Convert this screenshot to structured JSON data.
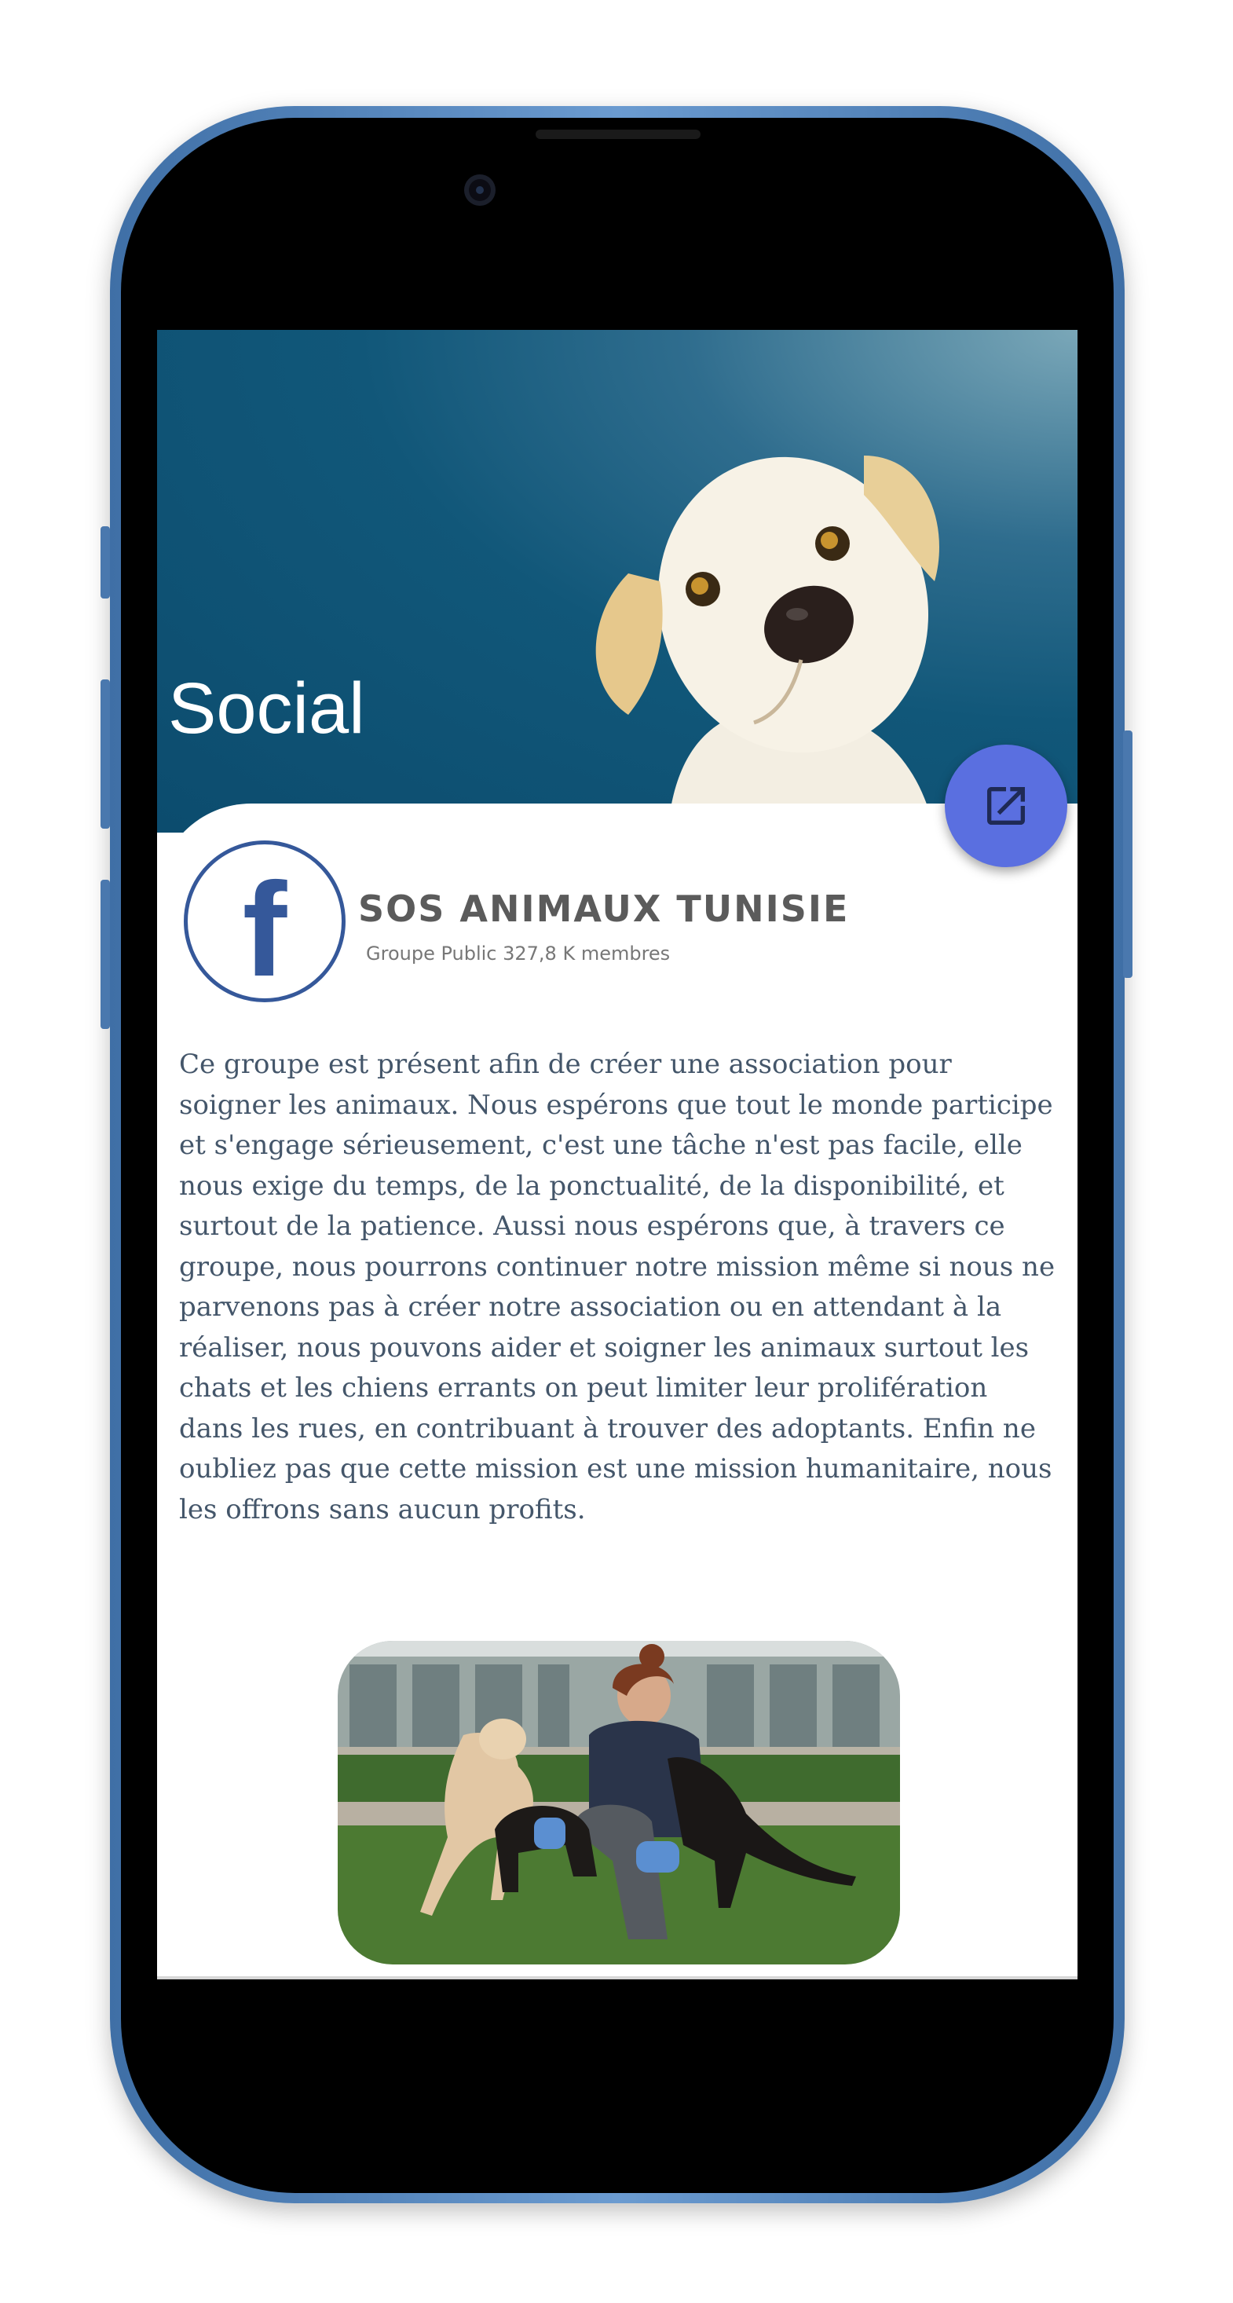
{
  "app": {
    "title": "Social"
  },
  "group": {
    "name": "SOS ANIMAUX TUNISIE",
    "meta": "Groupe Public 327,8 K membres",
    "description": "Ce groupe est présent afin de créer une association pour soigner les animaux. Nous espérons que tout le monde participe et s'engage sérieusement, c'est une tâche n'est pas facile, elle nous exige du temps, de la ponctualité, de la disponibilité, et surtout de la patience. Aussi nous espérons que, à travers ce groupe, nous pourrons continuer notre mission même si nous ne parvenons pas à créer notre association ou en attendant à la réaliser, nous pouvons aider et soigner les animaux surtout les chats et les chiens errants on peut limiter leur prolifération dans les rues, en contribuant à trouver des adoptants. Enfin ne oubliez pas que cette mission est une mission humanitaire, nous les offrons sans aucun profits."
  },
  "icons": {
    "open_link": "open-in-new-icon",
    "facebook": "facebook-logo-icon",
    "camera": "front-camera-icon"
  },
  "colors": {
    "hero_dark": "#0c4c6e",
    "hero_light": "#7aa7b8",
    "fab": "#5a6fe0",
    "facebook": "#35589a",
    "frame": "#4a78ae"
  }
}
